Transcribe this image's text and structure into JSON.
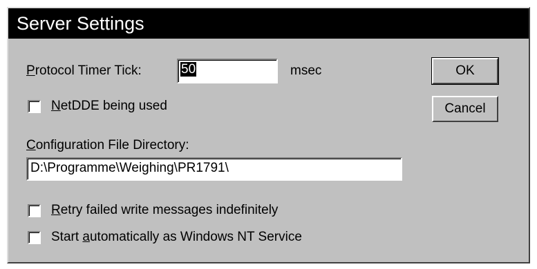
{
  "window": {
    "title": "Server Settings"
  },
  "timer": {
    "label_accel": "P",
    "label_rest": "rotocol Timer Tick:",
    "value": "50",
    "unit": "msec"
  },
  "netdde": {
    "label_accel": "N",
    "label_rest": "etDDE being used",
    "checked": false
  },
  "config_dir": {
    "label_accel": "C",
    "label_rest": "onfiguration File Directory:",
    "value": "D:\\Programme\\Weighing\\PR1791\\"
  },
  "retry": {
    "label_accel": "R",
    "label_rest": "etry failed write messages indefinitely",
    "checked": false
  },
  "service": {
    "label_before": "Start ",
    "label_accel": "a",
    "label_rest": "utomatically as Windows NT Service",
    "checked": false
  },
  "buttons": {
    "ok": "OK",
    "cancel": "Cancel"
  }
}
